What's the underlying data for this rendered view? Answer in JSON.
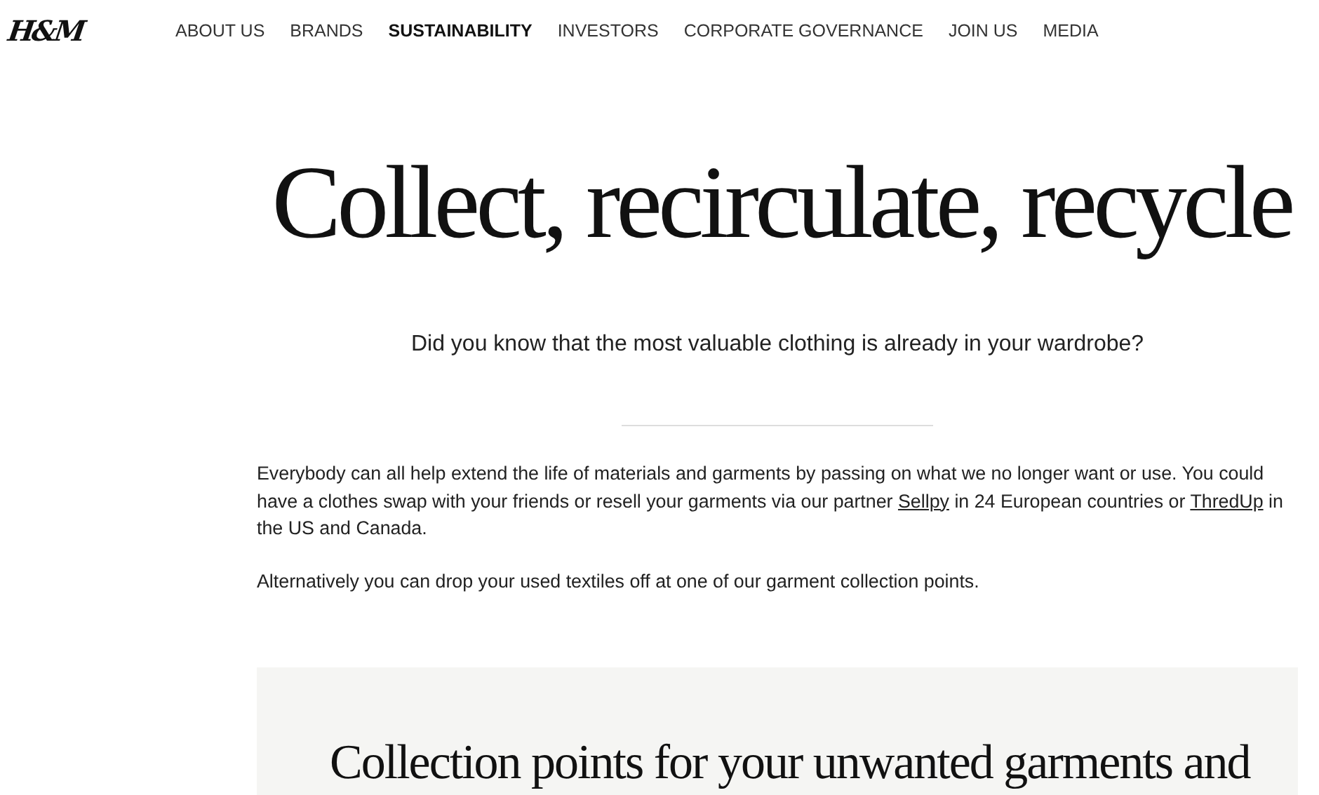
{
  "logo": "H&M",
  "nav": [
    {
      "label": "ABOUT US",
      "selected": false
    },
    {
      "label": "BRANDS",
      "selected": false
    },
    {
      "label": "SUSTAINABILITY",
      "selected": true
    },
    {
      "label": "INVESTORS",
      "selected": false
    },
    {
      "label": "CORPORATE GOVERNANCE",
      "selected": false
    },
    {
      "label": "JOIN US",
      "selected": false
    },
    {
      "label": "MEDIA",
      "selected": false
    }
  ],
  "heading": "Collect, recirculate, recycle",
  "subtitle": "Did you know that the most valuable clothing is already in your wardrobe?",
  "paragraphs": [
    [
      {
        "kind": "text",
        "text": "Everybody can all help extend the life of materials and garments by passing on what we no longer want or use. You could have a clothes swap with your friends or resell your garments via our partner "
      },
      {
        "kind": "link",
        "text": "Sellpy"
      },
      {
        "kind": "text",
        "text": " in 24 European countries or "
      },
      {
        "kind": "link",
        "text": "ThredUp"
      },
      {
        "kind": "text",
        "text": " in the US and Canada."
      }
    ],
    [
      {
        "kind": "text",
        "text": "Alternatively you can drop your used textiles off at one of our garment collection points."
      }
    ]
  ],
  "section": {
    "heading": "Collection points for your unwanted garments and"
  }
}
